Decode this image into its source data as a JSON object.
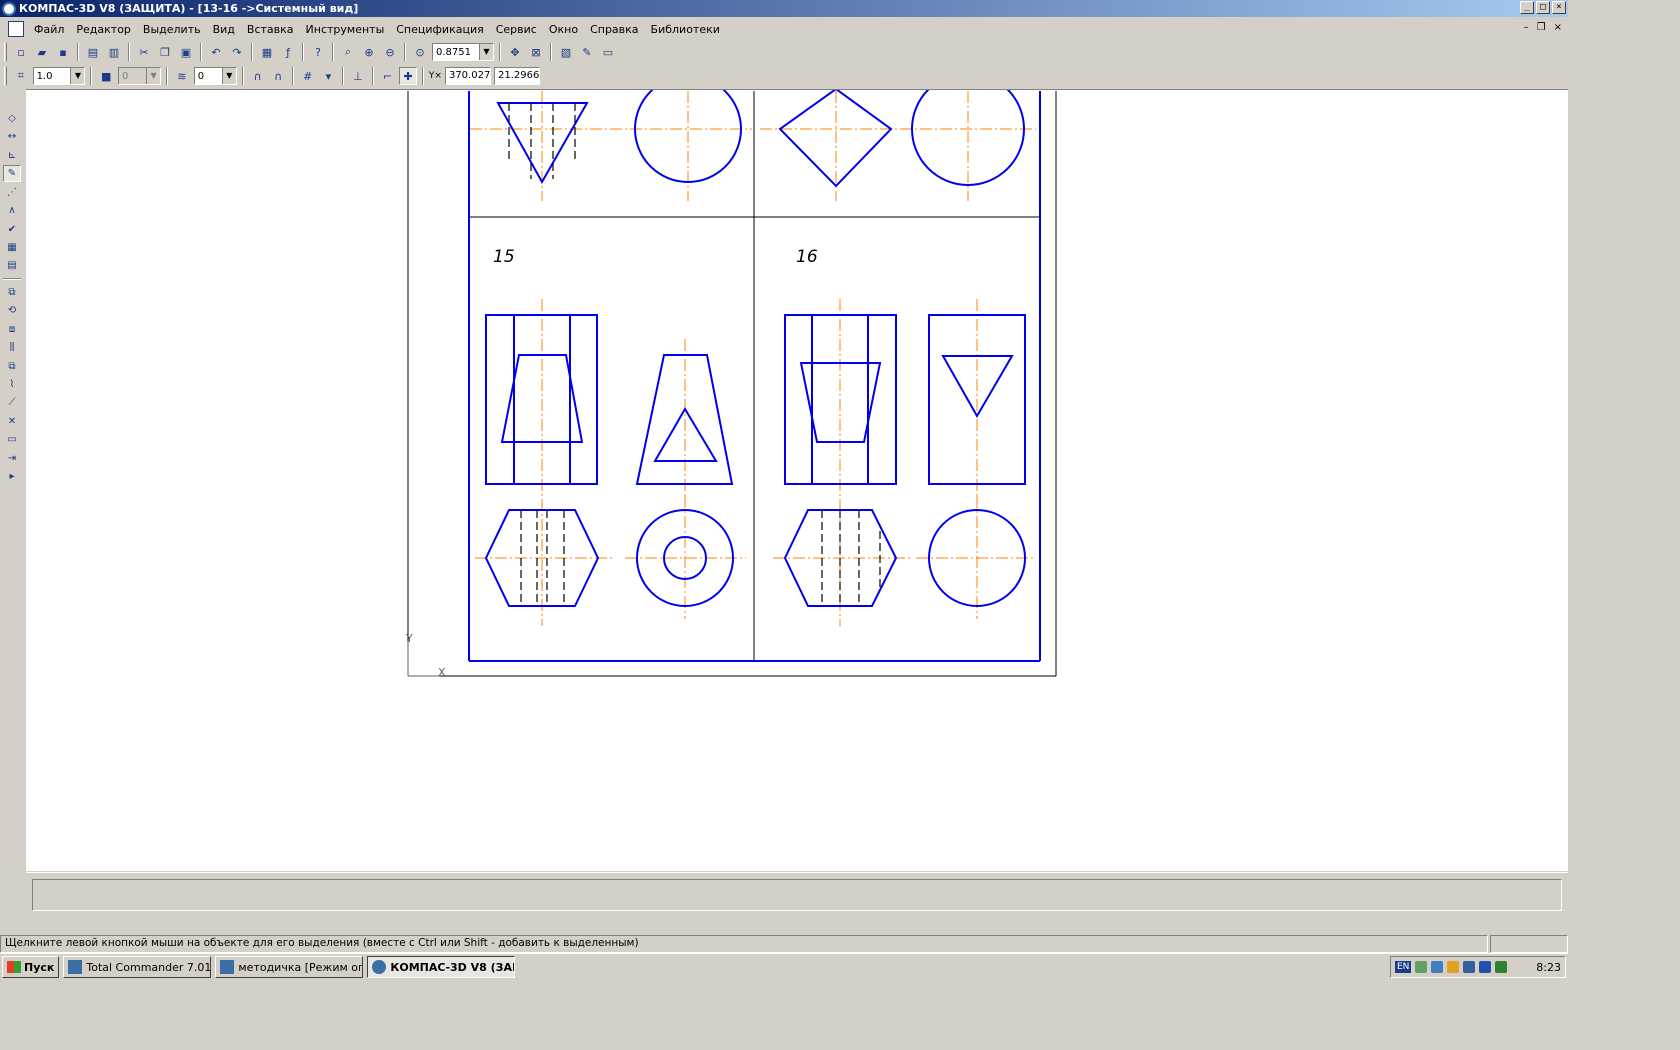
{
  "window": {
    "title": "КОМПАС-3D V8 (ЗАЩИТА) - [13-16 ->Системный вид]",
    "minimize": "_",
    "maximize": "□",
    "close": "×"
  },
  "menu": [
    "Файл",
    "Редактор",
    "Выделить",
    "Вид",
    "Вставка",
    "Инструменты",
    "Спецификация",
    "Сервис",
    "Окно",
    "Справка",
    "Библиотеки"
  ],
  "doc_controls": {
    "minimize": "–",
    "restore": "❐",
    "close": "×"
  },
  "toolbar": {
    "zoom_value": "0.8751",
    "step_value": "1.0",
    "style_value": "0",
    "layer_value": "0",
    "coord_x": "370.027",
    "coord_y": "21.2966",
    "coord_label": "Y×"
  },
  "drawing": {
    "label_15": "15",
    "label_16": "16",
    "axis_y": "Y",
    "axis_x": "X",
    "line_color": "#0000ee",
    "axis_color": "#ff8000"
  },
  "status": {
    "message": "Щелкните левой кнопкой мыши на объекте для его выделения (вместе с Ctrl или Shift - добавить к выделенным)"
  },
  "taskbar": {
    "start": "Пуск",
    "tasks": [
      {
        "label": "Total Commander 7.01 - ...",
        "active": false
      },
      {
        "label": "методичка [Режим огра...",
        "active": false
      },
      {
        "label": "КОМПАС-3D V8 (ЗАЩ...",
        "active": true
      }
    ],
    "lang": "EN",
    "clock": "8:23"
  }
}
